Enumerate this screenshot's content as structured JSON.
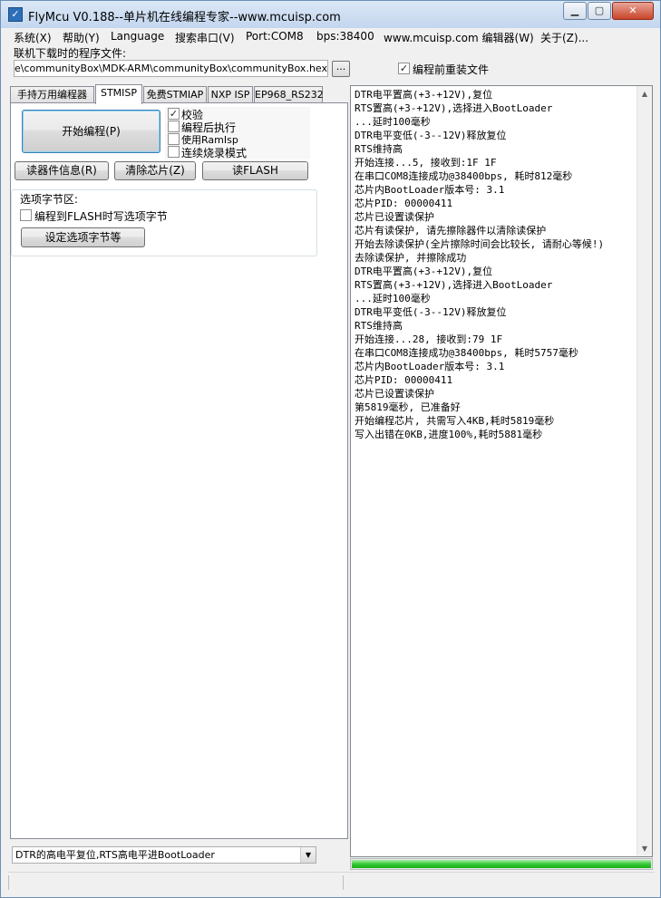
{
  "window": {
    "title": "FlyMcu V0.188--单片机在线编程专家--www.mcuisp.com",
    "icon": "flymcu-app-icon",
    "minimize_icon": "minimize-icon",
    "maximize_icon": "maximize-icon",
    "close_icon": "close-icon"
  },
  "menu": [
    "系统(X)",
    "帮助(Y)",
    "Language",
    "搜索串口(V)",
    "Port:COM8",
    "bps:38400",
    "www.mcuisp.com 编辑器(W)",
    "关于(Z)..."
  ],
  "file": {
    "label": "联机下载时的程序文件:",
    "path": "D:\\CubeMXCode\\communityBox\\MDK-ARM\\communityBox\\communityBox.hex",
    "browse_label": "...",
    "reload_label": "编程前重装文件",
    "reload_checked": true
  },
  "tabs": [
    "手持万用编程器",
    "STMISP",
    "免费STMIAP",
    "NXP ISP",
    "EP968_RS232"
  ],
  "active_tab": "STMISP",
  "stmisp": {
    "start_button": "开始编程(P)",
    "options": [
      {
        "label": "校验",
        "checked": true
      },
      {
        "label": "编程后执行",
        "checked": false
      },
      {
        "label": "使用RamIsp",
        "checked": false
      },
      {
        "label": "连续烧录模式",
        "checked": false
      }
    ],
    "read_info_button": "读器件信息(R)",
    "erase_button": "清除芯片(Z)",
    "read_flash_button": "读FLASH",
    "option_group_title": "选项字节区:",
    "write_option_label": "编程到FLASH时写选项字节",
    "write_option_checked": false,
    "set_option_button": "设定选项字节等"
  },
  "reset_mode": "DTR的高电平复位,RTS高电平进BootLoader",
  "log": [
    "DTR电平置高(+3-+12V),复位",
    "RTS置高(+3-+12V),选择进入BootLoader",
    "...延时100毫秒",
    "DTR电平变低(-3--12V)释放复位",
    "RTS维持高",
    "开始连接...5, 接收到:1F 1F",
    "在串口COM8连接成功@38400bps, 耗时812毫秒",
    "芯片内BootLoader版本号: 3.1",
    "芯片PID: 00000411",
    "芯片已设置读保护",
    "芯片有读保护, 请先擦除器件以清除读保护",
    "开始去除读保护(全片擦除时间会比较长, 请耐心等候!)",
    "去除读保护, 并擦除成功",
    "DTR电平置高(+3-+12V),复位",
    "RTS置高(+3-+12V),选择进入BootLoader",
    "...延时100毫秒",
    "DTR电平变低(-3--12V)释放复位",
    "RTS维持高",
    "开始连接...28, 接收到:79 1F",
    "在串口COM8连接成功@38400bps, 耗时5757毫秒",
    "芯片内BootLoader版本号: 3.1",
    "芯片PID: 00000411",
    "芯片已设置读保护",
    "第5819毫秒, 已准备好",
    "开始编程芯片, 共需写入4KB,耗时5819毫秒",
    "写入出错在0KB,进度100%,耗时5881毫秒"
  ],
  "progress": 1.0,
  "colors": {
    "progress": "#2cc02c",
    "titlebar": "#c9dbf0",
    "close": "#c9442a"
  }
}
